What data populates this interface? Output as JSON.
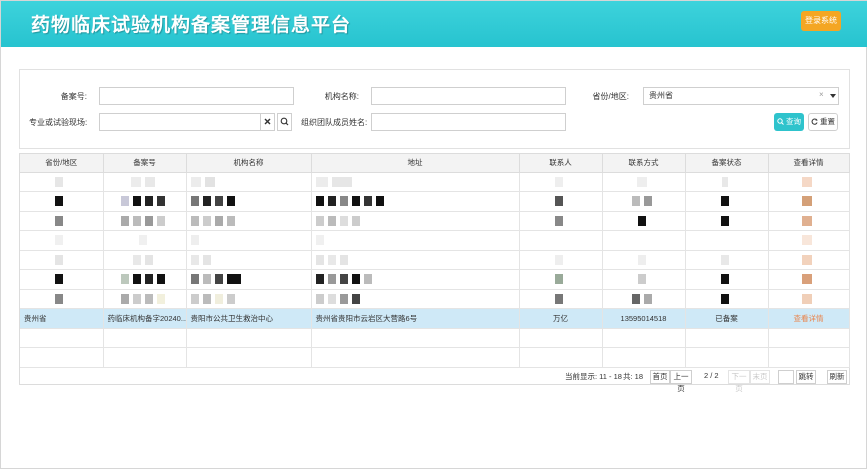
{
  "header": {
    "title": "药物临床试验机构备案管理信息平台",
    "login_label": "登录系统"
  },
  "search": {
    "record_no_label": "备案号:",
    "org_name_label": "机构名称:",
    "province_label": "省份/地区:",
    "province_value": "贵州省",
    "site_label": "专业或试验现场:",
    "member_label": "组织团队成员姓名:",
    "query_label": "查询",
    "reset_label": "重置"
  },
  "table": {
    "headers": [
      "省份/地区",
      "备案号",
      "机构名称",
      "地址",
      "联系人",
      "联系方式",
      "备案状态",
      "查看详情"
    ],
    "highlight_row": {
      "province": "贵州省",
      "record_no": "药临床机构备字20240...",
      "org_name": "贵阳市公共卫生救治中心",
      "address": "贵州省贵阳市云岩区大营路6号",
      "contact": "万亿",
      "phone": "13595014518",
      "status": "已备案",
      "detail": "查看详情"
    }
  },
  "pager": {
    "display": "当前显示: 11 - 18",
    "total": "共: 18",
    "first": "首页",
    "prev": "上一页",
    "page": "2 / 2",
    "next": "下一页",
    "last": "末页",
    "jump": "跳转",
    "refresh": "刷新"
  },
  "colors": {
    "header": "#2fcad5",
    "accent_button": "#f4a623",
    "query_button": "#2ec3cc",
    "highlight_row": "#cfe9f7",
    "link": "#e9834a"
  }
}
